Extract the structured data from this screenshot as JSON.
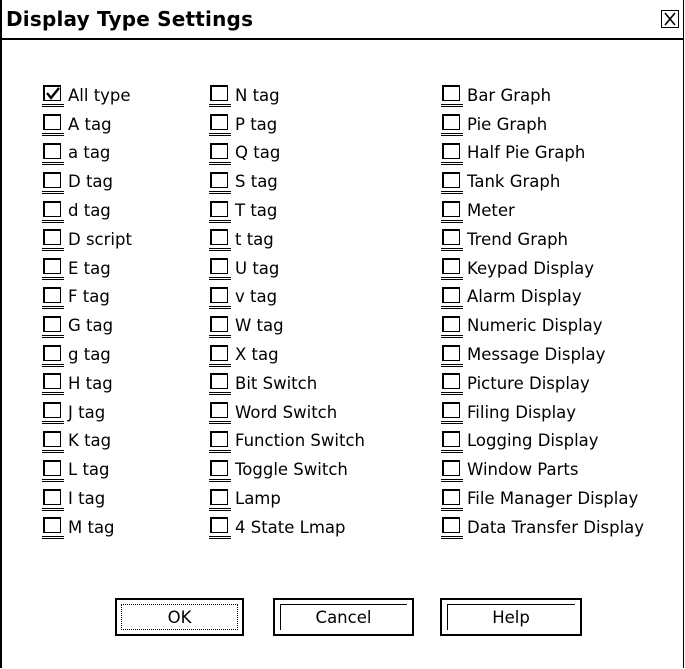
{
  "dialog": {
    "title": "Display Type Settings"
  },
  "columns": {
    "col1": [
      {
        "label": "All type",
        "checked": true
      },
      {
        "label": "A tag",
        "checked": false
      },
      {
        "label": "a tag",
        "checked": false
      },
      {
        "label": "D tag",
        "checked": false
      },
      {
        "label": "d tag",
        "checked": false
      },
      {
        "label": "D script",
        "checked": false
      },
      {
        "label": "E tag",
        "checked": false
      },
      {
        "label": "F tag",
        "checked": false
      },
      {
        "label": "G tag",
        "checked": false
      },
      {
        "label": "g tag",
        "checked": false
      },
      {
        "label": "H tag",
        "checked": false
      },
      {
        "label": "J tag",
        "checked": false
      },
      {
        "label": "K tag",
        "checked": false
      },
      {
        "label": "L tag",
        "checked": false
      },
      {
        "label": "I tag",
        "checked": false
      },
      {
        "label": "M tag",
        "checked": false
      }
    ],
    "col2": [
      {
        "label": "N tag",
        "checked": false
      },
      {
        "label": "P tag",
        "checked": false
      },
      {
        "label": "Q tag",
        "checked": false
      },
      {
        "label": "S tag",
        "checked": false
      },
      {
        "label": "T tag",
        "checked": false
      },
      {
        "label": "t tag",
        "checked": false
      },
      {
        "label": "U tag",
        "checked": false
      },
      {
        "label": "v tag",
        "checked": false
      },
      {
        "label": "W tag",
        "checked": false
      },
      {
        "label": "X tag",
        "checked": false
      },
      {
        "label": "Bit Switch",
        "checked": false
      },
      {
        "label": "Word Switch",
        "checked": false
      },
      {
        "label": "Function Switch",
        "checked": false
      },
      {
        "label": "Toggle Switch",
        "checked": false
      },
      {
        "label": "Lamp",
        "checked": false
      },
      {
        "label": "4 State Lmap",
        "checked": false
      }
    ],
    "col3": [
      {
        "label": "Bar Graph",
        "checked": false
      },
      {
        "label": "Pie Graph",
        "checked": false
      },
      {
        "label": "Half Pie Graph",
        "checked": false
      },
      {
        "label": "Tank Graph",
        "checked": false
      },
      {
        "label": "Meter",
        "checked": false
      },
      {
        "label": "Trend Graph",
        "checked": false
      },
      {
        "label": "Keypad Display",
        "checked": false
      },
      {
        "label": "Alarm Display",
        "checked": false
      },
      {
        "label": "Numeric Display",
        "checked": false
      },
      {
        "label": "Message Display",
        "checked": false
      },
      {
        "label": "Picture Display",
        "checked": false
      },
      {
        "label": "Filing Display",
        "checked": false
      },
      {
        "label": "Logging Display",
        "checked": false
      },
      {
        "label": "Window Parts",
        "checked": false
      },
      {
        "label": "File Manager Display",
        "checked": false
      },
      {
        "label": "Data Transfer Display",
        "checked": false
      }
    ]
  },
  "buttons": {
    "ok": "OK",
    "cancel": "Cancel",
    "help": "Help"
  },
  "icons": {
    "close": "close-icon",
    "check": "checkmark-icon"
  }
}
